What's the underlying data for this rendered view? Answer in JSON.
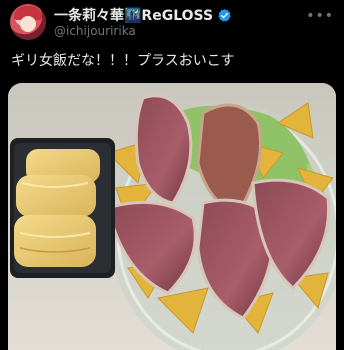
{
  "tweet": {
    "display_name": "一条莉々華🌃ReGLOSS",
    "handle": "@ichijouririka",
    "text": "ギリ女飯だな！！！プラスおいこす",
    "verified_color": "#1d9bf0"
  },
  "icons": [
    "avatar",
    "verified-badge-icon",
    "more-options-icon"
  ],
  "media": {
    "type": "photo"
  }
}
